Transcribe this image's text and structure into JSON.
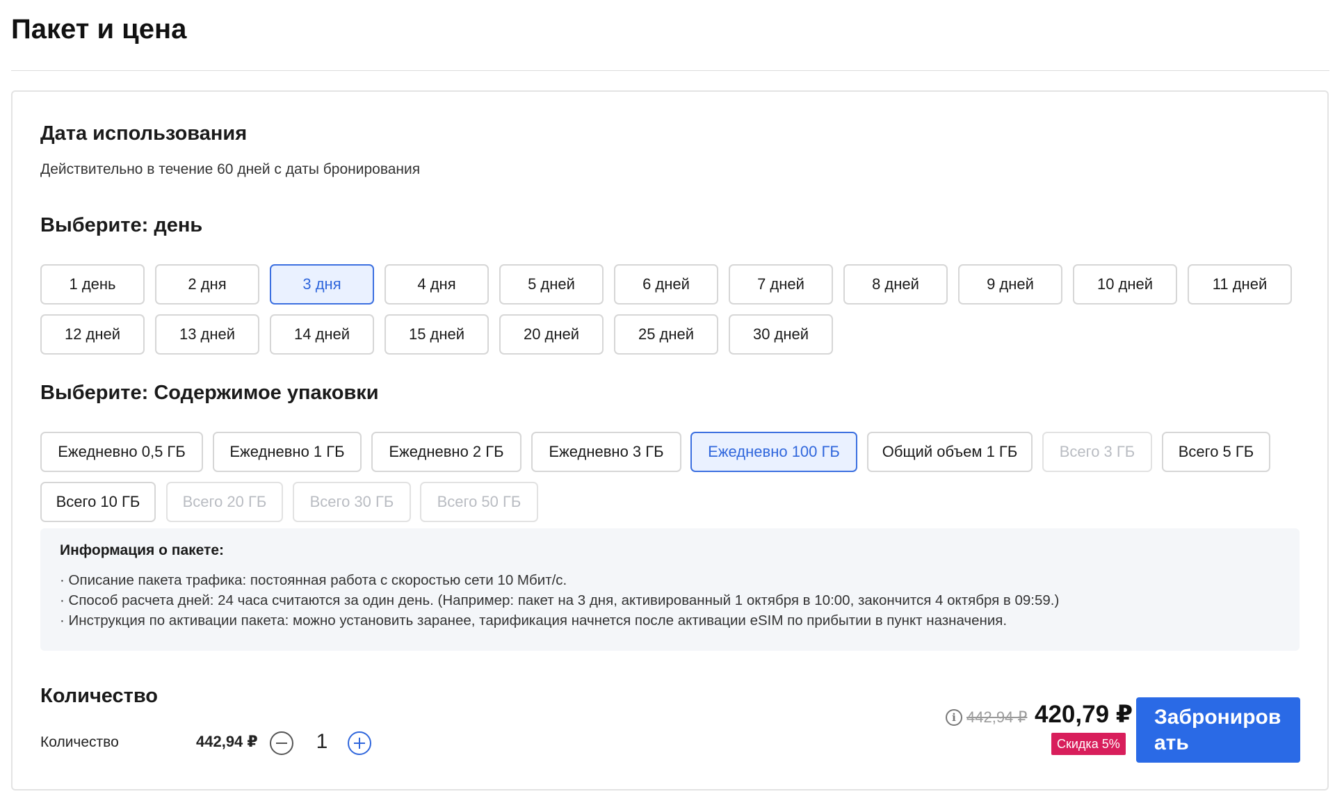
{
  "page": {
    "title": "Пакет и цена"
  },
  "usage": {
    "title": "Дата использования",
    "note": "Действительно в течение 60 дней с даты бронирования"
  },
  "days": {
    "title": "Выберите: день",
    "options": [
      "1 день",
      "2 дня",
      "3 дня",
      "4 дня",
      "5 дней",
      "6 дней",
      "7 дней",
      "8 дней",
      "9 дней",
      "10 дней",
      "11 дней",
      "12 дней",
      "13 дней",
      "14 дней",
      "15 дней",
      "20 дней",
      "25 дней",
      "30 дней"
    ],
    "selected": "3 дня"
  },
  "contents": {
    "title": "Выберите: Содержимое упаковки",
    "options": [
      "Ежедневно 0,5 ГБ",
      "Ежедневно 1 ГБ",
      "Ежедневно 2 ГБ",
      "Ежедневно 3 ГБ",
      "Ежедневно 100 ГБ",
      "Общий объем 1 ГБ",
      "Всего 3 ГБ",
      "Всего 5 ГБ",
      "Всего 10 ГБ",
      "Всего 20 ГБ",
      "Всего 30 ГБ",
      "Всего 50 ГБ"
    ],
    "selected": "Ежедневно 100 ГБ",
    "disabled": [
      "Всего 3 ГБ",
      "Всего 20 ГБ",
      "Всего 30 ГБ",
      "Всего 50 ГБ"
    ]
  },
  "package_info": {
    "title": "Информация о пакете:",
    "lines": [
      "· Описание пакета трафика: постоянная работа с скоростью сети 10 Мбит/с.",
      "· Способ расчета дней: 24 часа считаются за один день. (Например: пакет на 3 дня, активированный 1 октября в 10:00, закончится 4 октября в 09:59.)",
      "· Инструкция по активации пакета: можно установить заранее, тарификация начнется после активации eSIM по прибытии в пункт назначения."
    ]
  },
  "quantity": {
    "title": "Количество",
    "label": "Количество",
    "unit_price": "442,94 ₽",
    "value": "1"
  },
  "price": {
    "info_icon": "i",
    "old": "442,94 ₽",
    "new": "420,79 ₽",
    "discount": "Скидка 5%"
  },
  "book_button": {
    "label": "Забронировать"
  },
  "colors": {
    "accent": "#2a6ae6",
    "selected_bg": "#eaf1ff",
    "discount": "#d81e5b"
  }
}
